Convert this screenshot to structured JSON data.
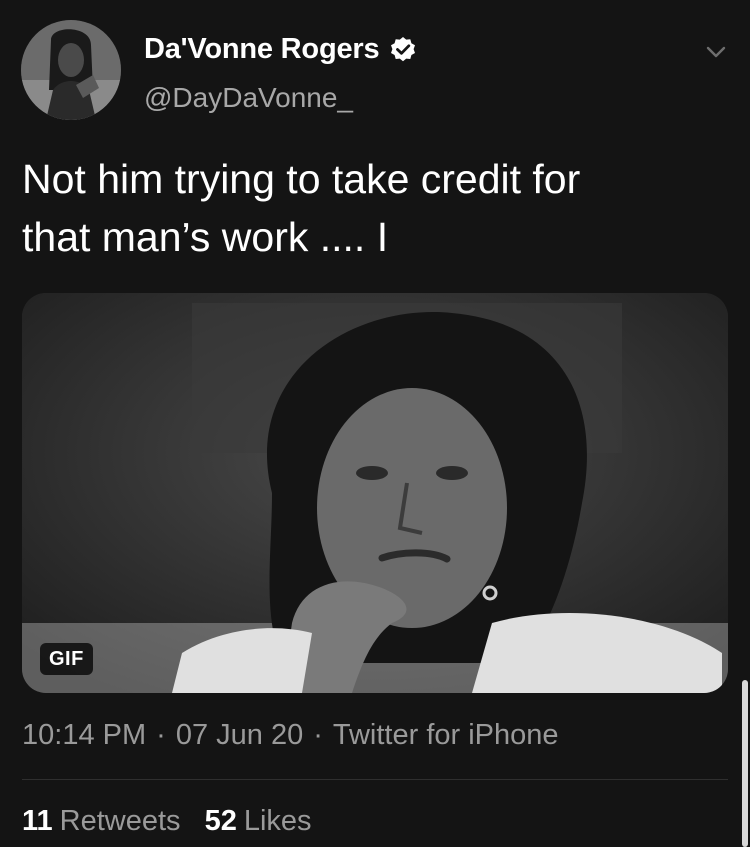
{
  "tweet": {
    "display_name": "Da'Vonne Rogers",
    "handle": "@DayDaVonne_",
    "verified": true,
    "text": "Not him trying to take credit for\nthat man’s work .... I",
    "media": {
      "badge": "GIF"
    },
    "time": "10:14 PM",
    "date": "07 Jun 20",
    "source": "Twitter for iPhone",
    "separator": "·",
    "retweets": {
      "count": "11",
      "label": "Retweets"
    },
    "likes": {
      "count": "52",
      "label": "Likes"
    }
  },
  "icons": {
    "verified": "verified-badge-icon",
    "more": "chevron-down-icon"
  },
  "colors": {
    "background": "#141414",
    "primary_text": "#ffffff",
    "secondary_text": "#9a9a9a"
  }
}
